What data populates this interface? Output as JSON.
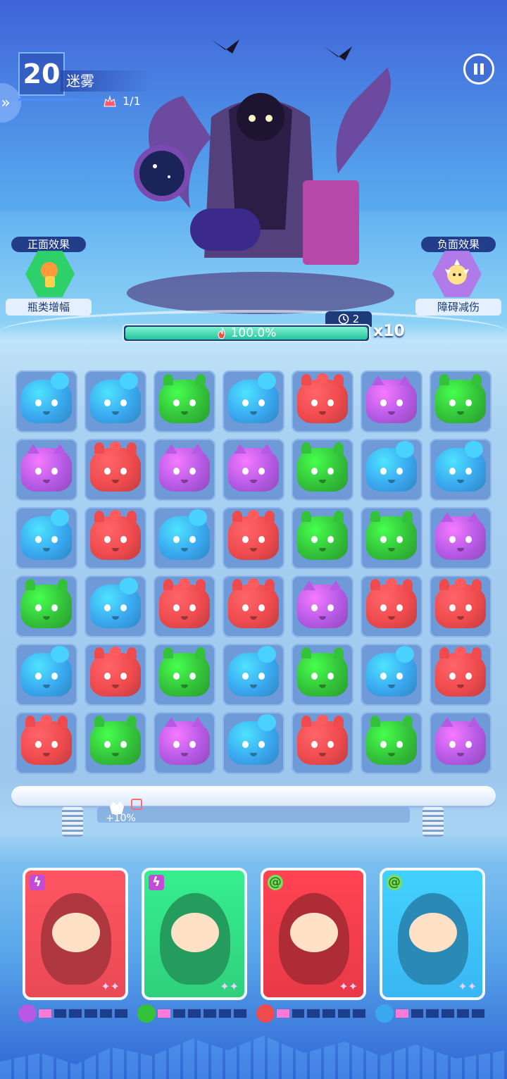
{
  "header": {
    "stage_number": "20",
    "stage_name": "迷雾",
    "wave": "1/1"
  },
  "positive_effect": {
    "title": "正面效果",
    "label": "瓶类增幅"
  },
  "negative_effect": {
    "title": "负面效果",
    "label": "障碍减伤"
  },
  "boss": {
    "hp_percent_text": "100.0%",
    "hp_fraction": 1.0,
    "turns": "2",
    "multiplier": "x10"
  },
  "board": {
    "token_colors": {
      "blue": "#3aa8f0",
      "green": "#34c23a",
      "red": "#ef4b4e",
      "purple": "#b65ae6"
    },
    "rows": [
      [
        "blue",
        "blue",
        "green",
        "blue",
        "red",
        "purple",
        "green"
      ],
      [
        "purple",
        "red",
        "purple",
        "purple",
        "green",
        "blue",
        "blue"
      ],
      [
        "blue",
        "red",
        "blue",
        "red",
        "green",
        "green",
        "purple"
      ],
      [
        "green",
        "blue",
        "red",
        "red",
        "purple",
        "red",
        "red"
      ],
      [
        "blue",
        "red",
        "green",
        "blue",
        "green",
        "blue",
        "red"
      ],
      [
        "red",
        "green",
        "purple",
        "blue",
        "red",
        "green",
        "purple"
      ]
    ]
  },
  "skill_bar": {
    "bonus": "+10%"
  },
  "heroes": [
    {
      "name": "tiger-hero",
      "element": "lightning",
      "bg": "#e94a55",
      "token": "purple",
      "energy": 1,
      "stars": "✦✦"
    },
    {
      "name": "skull-hero",
      "element": "lightning",
      "bg": "#2fd07c",
      "token": "green",
      "energy": 1,
      "stars": "✦✦"
    },
    {
      "name": "opera-hero",
      "element": "swirl",
      "bg": "#e83a48",
      "token": "red",
      "energy": 1,
      "stars": "✦✦"
    },
    {
      "name": "candy-hero",
      "element": "swirl",
      "bg": "#39b7f2",
      "token": "blue",
      "energy": 1,
      "stars": "✦✦"
    }
  ]
}
